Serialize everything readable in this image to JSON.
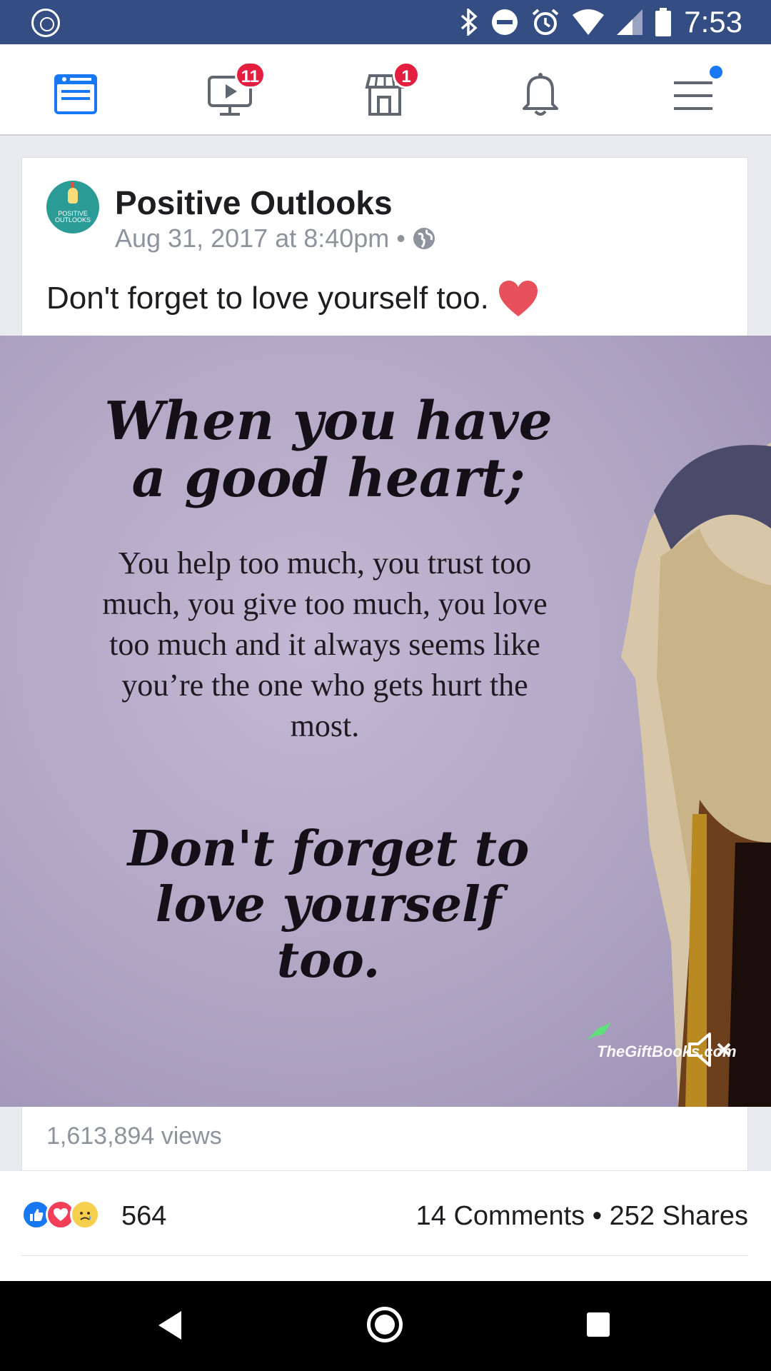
{
  "status_bar": {
    "time": "7:53"
  },
  "nav": {
    "items": [
      {
        "name": "news-feed",
        "badge": ""
      },
      {
        "name": "watch",
        "badge": "11"
      },
      {
        "name": "marketplace",
        "badge": "1"
      },
      {
        "name": "notifications",
        "badge": ""
      },
      {
        "name": "menu",
        "badge": ""
      }
    ],
    "active_color": "#1877f2",
    "icon_color": "#606770"
  },
  "post": {
    "page_name": "Positive Outlooks",
    "avatar_text": "POSITIVE OUTLOOKS",
    "timestamp": "Aug 31, 2017 at 8:40pm",
    "separator": "•",
    "text": "Don't forget to love yourself too.",
    "media": {
      "title": "When you have a good heart;",
      "body": "You help too much, you trust too much, you give too much, you love too much and it always seems like you’re the one who gets hurt the most.",
      "ending": "Don't forget to love yourself too.",
      "watermark": "TheGiftBooks.com"
    },
    "views": "1,613,894 views",
    "reaction_count": "564",
    "comments": "14 Comments",
    "shares": "252 Shares",
    "stats_separator": "•"
  }
}
